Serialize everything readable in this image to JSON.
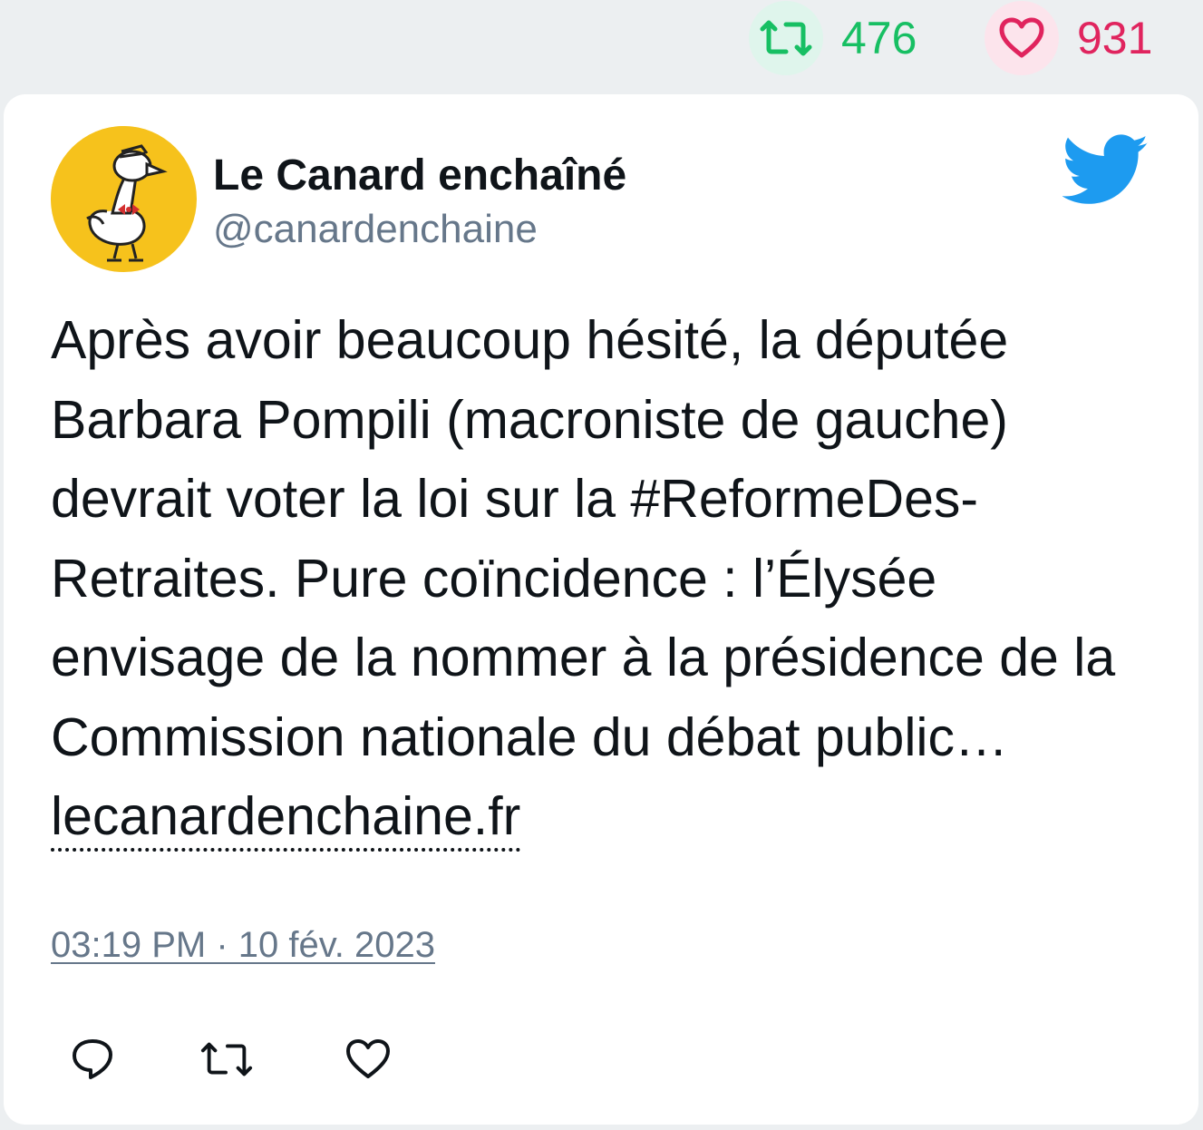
{
  "stats": {
    "retweets": "476",
    "likes": "931",
    "retweet_color": "#17bf63",
    "like_color": "#e0245e"
  },
  "tweet": {
    "author_name": "Le Canard enchaîné",
    "author_handle": "@canardenchaine",
    "text_before_link": "Après avoir beaucoup hésité, la députée Barbara Pompili (macroniste de gauche) devrait voter la loi sur la #ReformeDes-Retraites. Pure coïncidence : l’Élysée envisage de la nommer à la présidence de la Commission nationale du débat public… ",
    "link_text": "lecanardenchaine.fr",
    "timestamp": "03:19 PM · 10 fév. 2023"
  },
  "icons": {
    "retweet": "retweet-icon",
    "like": "heart-icon",
    "reply": "reply-icon",
    "brand": "twitter-bird-icon"
  },
  "colors": {
    "twitter_blue": "#1d9bf0",
    "avatar_background": "#f6c21c"
  }
}
